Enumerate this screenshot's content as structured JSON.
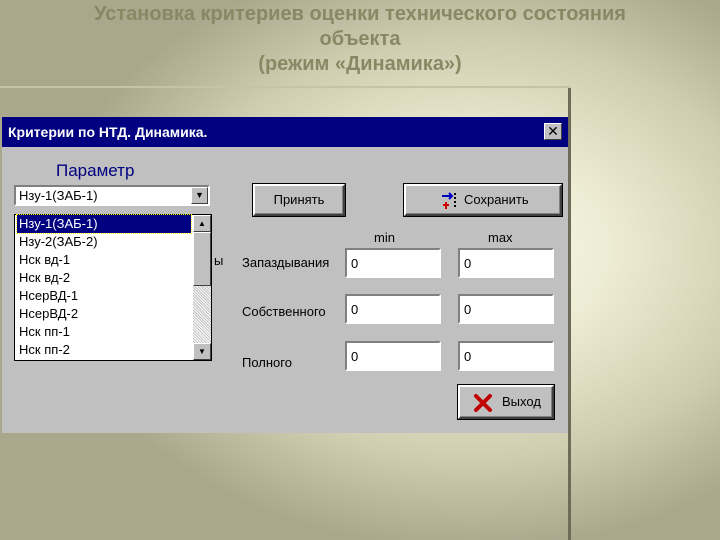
{
  "slide": {
    "title_lines": [
      "Установка критериев оценки технического состояния",
      "объекта",
      "(режим «Динамика»)"
    ]
  },
  "window": {
    "title": "Критерии по НТД. Динамика.",
    "close_glyph": "✕"
  },
  "param_label": "Параметр",
  "combo_value": "Нзу-1(ЗАБ-1)",
  "list_items": [
    "Нзу-1(ЗАБ-1)",
    "Нзу-2(ЗАБ-2)",
    "Нск вд-1",
    "Нск вд-2",
    "НсерВД-1",
    "НсерВД-2",
    "Нск пп-1",
    "Нск пп-2"
  ],
  "selected_index": 0,
  "hidden_label_fragment": "ы",
  "buttons": {
    "accept": "Принять",
    "save": "Сохранить",
    "exit": "Выход"
  },
  "columns": {
    "min": "min",
    "max": "max"
  },
  "rows": [
    {
      "label": "Запаздывания",
      "min": "0",
      "max": "0"
    },
    {
      "label": "Собственного",
      "min": "0",
      "max": "0"
    },
    {
      "label": "Полного",
      "min": "0",
      "max": "0"
    }
  ],
  "colors": {
    "titlebar": "#000080",
    "slide_title": "#8a8864",
    "selection": "#000080",
    "exit_icon": "#c00000"
  },
  "icons": {
    "save": "save-arrows-icon",
    "exit": "red-x-icon"
  }
}
